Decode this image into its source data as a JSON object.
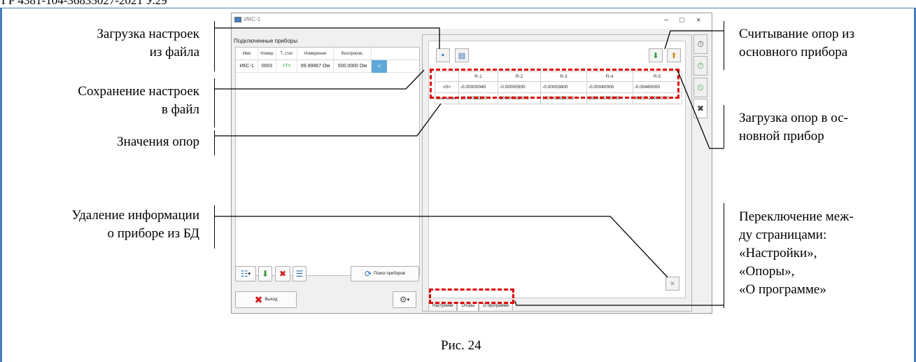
{
  "header_fragment": "ГР 4381-104-36835027-2021  У.29",
  "callouts": {
    "load_settings": [
      "Загрузка настроек",
      "из файла"
    ],
    "save_settings": [
      "Сохранение настроек",
      "в файл"
    ],
    "ref_values": "Значения опор",
    "delete_info": [
      "Удаление информации",
      "о приборе из  БД"
    ],
    "read_refs": [
      "Считывание опор из",
      "основного прибора"
    ],
    "load_refs": [
      "Загрузка опор в ос-",
      "новной прибор"
    ],
    "switch_pages": [
      "Переключение меж-",
      "ду страницами:",
      "«Настройки»,",
      "«Опоры»,",
      "«О программе»"
    ]
  },
  "caption": "Рис. 24",
  "window": {
    "title": "ИКС-1",
    "controls": {
      "minimize": "−",
      "maximize": "□",
      "close": "×"
    },
    "left_panel": {
      "title": "Подключенные приборы",
      "columns": [
        "Имя",
        "Номер",
        "Т. стат",
        "Измерение",
        "Воспроизв.",
        ""
      ],
      "rows": [
        {
          "name": "ИКС-1",
          "number": "0003",
          "tstat": ">T<",
          "measurement": "99.99867 Ом",
          "reproduction": "500.0000 Ом",
          "action": "<"
        }
      ],
      "search_label": "Поиск приборов",
      "exit_label": "Выход"
    },
    "refs_table": {
      "headers": [
        "",
        "R-1",
        "R-2",
        "R-3",
        "R-4",
        "R-5"
      ],
      "rows": [
        {
          "label": "<0>",
          "values": [
            "-0.00000040",
            "-0.00000500",
            "-0.00003800",
            "-0.00040000",
            "-0.00460000"
          ]
        },
        {
          "label": "Значение",
          "values": [
            "10.00023200",
            "100.00682000",
            "1000.02650000",
            "9999.66700000",
            "99997.25000000"
          ]
        }
      ]
    },
    "tabs": [
      "Настройки",
      "Опоры",
      "О программе"
    ],
    "colors": {
      "accent": "#5ea9d8",
      "highlight": "#e00000",
      "frame": "#4a7ebb"
    }
  }
}
